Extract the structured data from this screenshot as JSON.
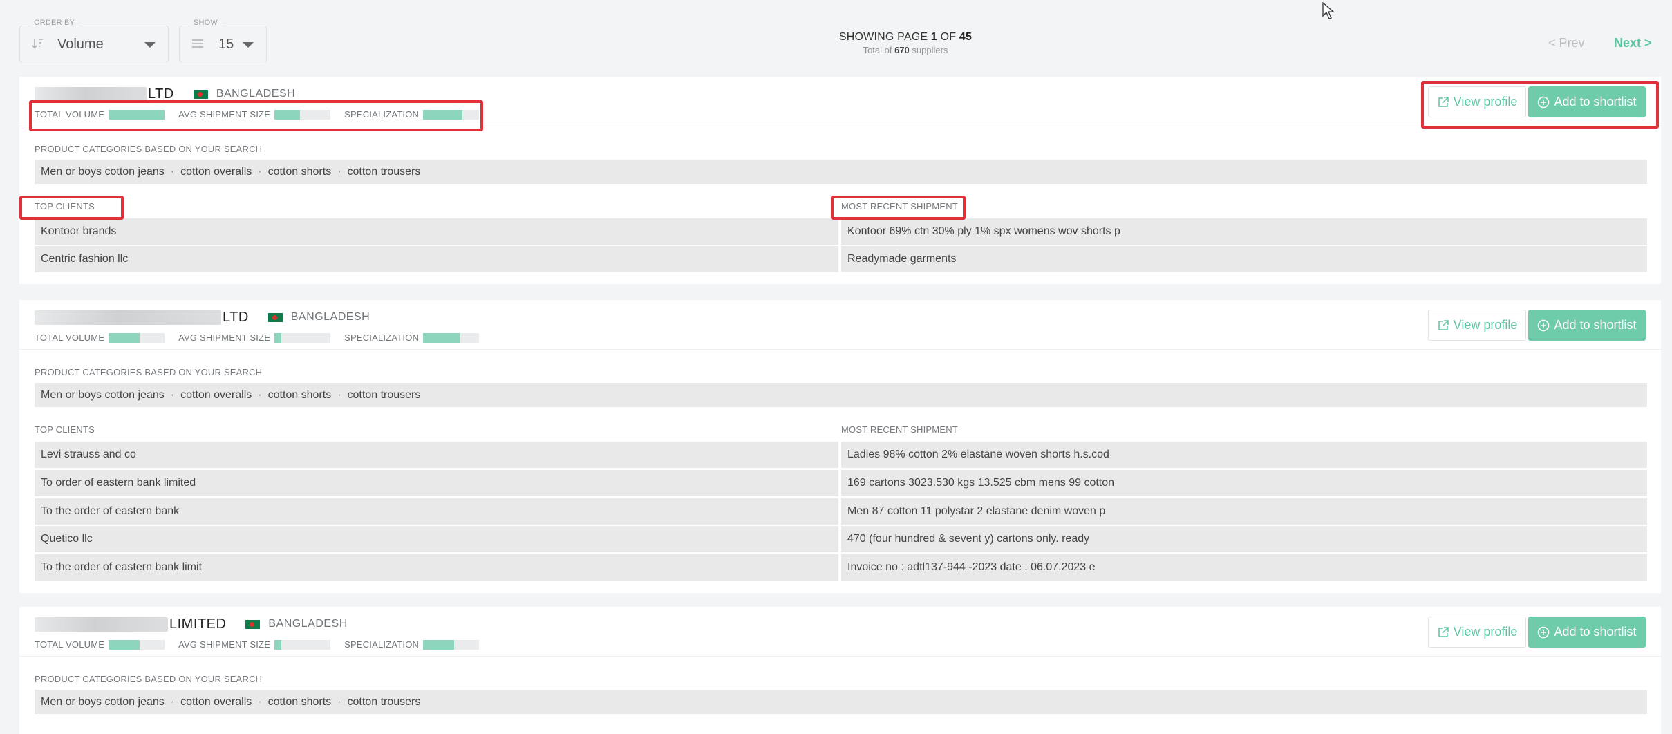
{
  "order_by": {
    "label": "ORDER BY",
    "value": "Volume",
    "icon": "sort-icon"
  },
  "show": {
    "label": "SHOW",
    "value": "15",
    "icon": "list-icon"
  },
  "paging": {
    "showing_prefix": "SHOWING PAGE ",
    "page": "1",
    "of_text": " OF ",
    "total_pages": "45",
    "total_prefix": "Total of ",
    "total_count": "670",
    "total_suffix": " suppliers",
    "prev_label": "< Prev",
    "next_label": "Next >"
  },
  "labels": {
    "total_volume": "TOTAL VOLUME",
    "avg_shipment": "AVG SHIPMENT SIZE",
    "specialization": "SPECIALIZATION",
    "product_categories": "PRODUCT CATEGORIES BASED ON YOUR SEARCH",
    "top_clients": "TOP CLIENTS",
    "most_recent": "MOST RECENT SHIPMENT",
    "view_profile": "View profile",
    "add_shortlist": "Add to shortlist"
  },
  "colors": {
    "accent": "#6fccab",
    "highlight": "#e0313b",
    "bar_fill": "#8dd6bd"
  },
  "suppliers": [
    {
      "name_suffix": "LTD",
      "country": "BANGLADESH",
      "total_volume": 1.0,
      "avg_shipment": 0.45,
      "specialization": 0.7,
      "categories": [
        "Men or boys cotton jeans",
        "cotton overalls",
        "cotton shorts",
        "cotton trousers"
      ],
      "clients": [
        "Kontoor brands",
        "Centric fashion llc"
      ],
      "shipments": [
        "Kontoor 69% ctn 30% ply 1% spx womens wov shorts p",
        "Readymade garments"
      ]
    },
    {
      "name_suffix": "LTD",
      "country": "BANGLADESH",
      "total_volume": 0.55,
      "avg_shipment": 0.12,
      "specialization": 0.65,
      "categories": [
        "Men or boys cotton jeans",
        "cotton overalls",
        "cotton shorts",
        "cotton trousers"
      ],
      "clients": [
        "Levi strauss and co",
        "To order of eastern bank limited",
        "To the order of eastern bank",
        "Quetico llc",
        "To the order of eastern bank limit"
      ],
      "shipments": [
        "Ladies 98% cotton 2% elastane woven shorts h.s.cod",
        "169 cartons 3023.530 kgs 13.525 cbm mens 99 cotton",
        "Men 87 cotton 11 polystar 2 elastane denim woven p",
        "470 (four hundred & sevent y) cartons only. ready",
        "Invoice no : adtl137-944 -2023 date : 06.07.2023 e"
      ]
    },
    {
      "name_suffix": "LIMITED",
      "country": "BANGLADESH",
      "total_volume": 0.55,
      "avg_shipment": 0.12,
      "specialization": 0.55,
      "categories": [
        "Men or boys cotton jeans",
        "cotton overalls",
        "cotton shorts",
        "cotton trousers"
      ]
    }
  ]
}
